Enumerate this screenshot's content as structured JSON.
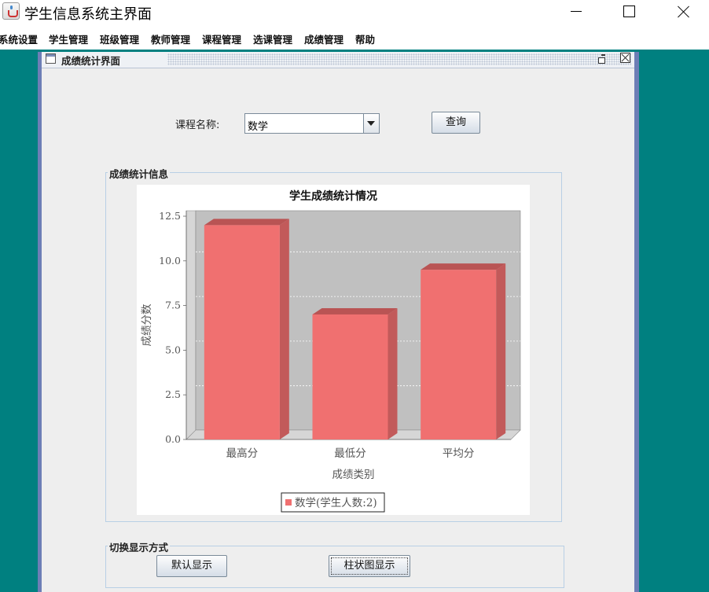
{
  "window": {
    "title": "学生信息系统主界面"
  },
  "menu": [
    "系统设置",
    "学生管理",
    "班级管理",
    "教师管理",
    "课程管理",
    "选课管理",
    "成绩管理",
    "帮助"
  ],
  "internal_frame": {
    "title": "成绩统计界面"
  },
  "query": {
    "course_label": "课程名称:",
    "course_value": "数学",
    "query_button": "查询"
  },
  "stats_group": {
    "title": "成绩统计信息"
  },
  "switch_group": {
    "title": "切换显示方式",
    "default_button": "默认显示",
    "bar_button": "柱状图显示"
  },
  "chart_data": {
    "type": "bar",
    "title": "学生成绩统计情况",
    "xlabel": "成绩类别",
    "ylabel": "成绩分数",
    "categories": [
      "最高分",
      "最低分",
      "平均分"
    ],
    "series": [
      {
        "name": "数学(学生人数:2)",
        "values": [
          12,
          7,
          9.5
        ]
      }
    ],
    "ylim": [
      0,
      12.5
    ],
    "yticks": [
      "0.0",
      "2.5",
      "5.0",
      "7.5",
      "10.0",
      "12.5"
    ],
    "grid": true,
    "legend": "bottom",
    "colors": {
      "bar": "#f07070",
      "bar_side": "#c25a5a",
      "bar_top": "#b95454",
      "plot_bg": "#c0c0c0"
    }
  }
}
